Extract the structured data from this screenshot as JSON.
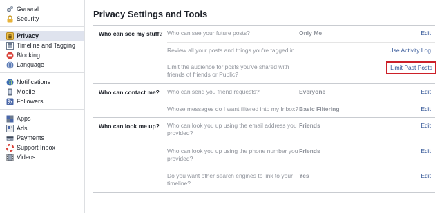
{
  "sidebar": {
    "groups": [
      {
        "items": [
          {
            "label": "General",
            "icon": "gears-icon"
          },
          {
            "label": "Security",
            "icon": "lock-icon"
          }
        ]
      },
      {
        "items": [
          {
            "label": "Privacy",
            "icon": "padlock-icon",
            "active": true
          },
          {
            "label": "Timeline and Tagging",
            "icon": "timeline-icon"
          },
          {
            "label": "Blocking",
            "icon": "blocking-icon"
          },
          {
            "label": "Language",
            "icon": "globe-icon"
          }
        ]
      },
      {
        "items": [
          {
            "label": "Notifications",
            "icon": "globe-notification-icon"
          },
          {
            "label": "Mobile",
            "icon": "mobile-icon"
          },
          {
            "label": "Followers",
            "icon": "rss-icon"
          }
        ]
      },
      {
        "items": [
          {
            "label": "Apps",
            "icon": "apps-icon"
          },
          {
            "label": "Ads",
            "icon": "ads-icon"
          },
          {
            "label": "Payments",
            "icon": "payments-icon"
          },
          {
            "label": "Support Inbox",
            "icon": "lifebuoy-icon"
          },
          {
            "label": "Videos",
            "icon": "film-icon"
          }
        ]
      }
    ]
  },
  "main": {
    "title": "Privacy Settings and Tools",
    "sections": [
      {
        "title": "Who can see my stuff?",
        "rows": [
          {
            "label": "Who can see your future posts?",
            "value": "Only Me",
            "action": "Edit"
          },
          {
            "label": "Review all your posts and things you're tagged in",
            "value": "",
            "action": "Use Activity Log"
          },
          {
            "label": "Limit the audience for posts you've shared with friends of friends or Public?",
            "value": "",
            "action": "Limit Past Posts",
            "highlighted": true
          }
        ]
      },
      {
        "title": "Who can contact me?",
        "rows": [
          {
            "label": "Who can send you friend requests?",
            "value": "Everyone",
            "action": "Edit"
          },
          {
            "label": "Whose messages do I want filtered into my Inbox?",
            "value": "Basic Filtering",
            "action": "Edit"
          }
        ]
      },
      {
        "title": "Who can look me up?",
        "rows": [
          {
            "label": "Who can look you up using the email address you provided?",
            "value": "Friends",
            "action": "Edit"
          },
          {
            "label": "Who can look you up using the phone number you provided?",
            "value": "Friends",
            "action": "Edit"
          },
          {
            "label": "Do you want other search engines to link to your timeline?",
            "value": "Yes",
            "action": "Edit"
          }
        ]
      }
    ]
  },
  "colors": {
    "link": "#365899",
    "highlight_border": "#cc2029",
    "active_bg": "#dfe3ee",
    "muted_text": "#90949c"
  }
}
